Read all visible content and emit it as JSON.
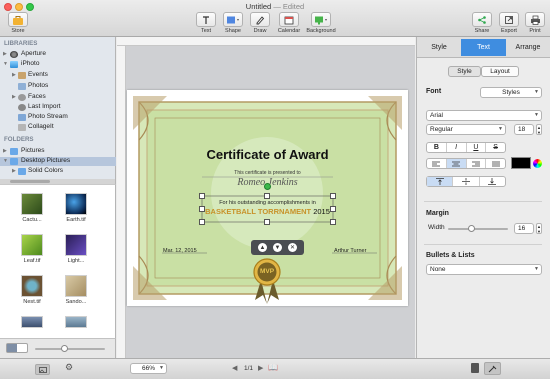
{
  "window": {
    "title": "Untitled",
    "edited": "— Edited"
  },
  "toolbar": {
    "store": "Store",
    "text": "Text",
    "shape": "Shape",
    "draw": "Draw",
    "calendar": "Calendar",
    "background": "Background",
    "share": "Share",
    "export": "Export",
    "print": "Print"
  },
  "sidebar": {
    "libraries_header": "LIBRARIES",
    "aperture": "Aperture",
    "iphoto": "iPhoto",
    "events": "Events",
    "photos": "Photos",
    "faces": "Faces",
    "last_import": "Last Import",
    "photo_stream": "Photo Stream",
    "collage": "CollageIt",
    "folders_header": "FOLDERS",
    "pictures": "Pictures",
    "desktop_pictures": "Desktop Pictures",
    "solid_colors": "Solid Colors"
  },
  "thumbs": [
    "Cactu...",
    "Earth.tif",
    "Leaf.tif",
    "Light...",
    "Nest.tif",
    "Sando...",
    "",
    ""
  ],
  "certificate": {
    "title": "Certificate of Award",
    "presented": "This certificate is presented to",
    "name": "Romeo Jenkins",
    "for_line": "For his outstanding accomplishments in",
    "event": "BASKETBALL TORRNAMENT",
    "year": "2015",
    "date": "Mar. 12, 2015",
    "signer": "Arthur Turner",
    "badge": "MVP"
  },
  "inspector": {
    "tabs": [
      "Style",
      "Text",
      "Arrange"
    ],
    "sub_tabs": [
      "Style",
      "Layout"
    ],
    "font_label": "Font",
    "styles_button": "Styles",
    "font_family": "Arial",
    "font_style": "Regular",
    "font_size": "18",
    "bold": "B",
    "italic": "I",
    "underline": "U",
    "strike": "S",
    "margin_label": "Margin",
    "width_label": "Width",
    "width_value": "16",
    "bullets_label": "Bullets & Lists",
    "bullets_value": "None",
    "text_color": "#000000"
  },
  "status": {
    "zoom": "66%",
    "page": "1/1"
  }
}
